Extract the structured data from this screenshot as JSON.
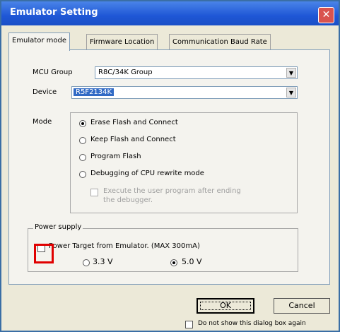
{
  "window": {
    "title": "Emulator Setting",
    "close_glyph": "✕"
  },
  "tabs": [
    {
      "label": "Emulator mode"
    },
    {
      "label": "Firmware Location"
    },
    {
      "label": "Communication Baud Rate"
    }
  ],
  "mcu_group": {
    "label": "MCU Group",
    "value": "R8C/34K Group"
  },
  "device": {
    "label": "Device",
    "value": "R5F2134K"
  },
  "mode": {
    "label": "Mode",
    "options": [
      {
        "label": "Erase Flash and Connect",
        "selected": true
      },
      {
        "label": "Keep Flash and Connect",
        "selected": false
      },
      {
        "label": "Program Flash",
        "selected": false
      },
      {
        "label": "Debugging of CPU rewrite mode",
        "selected": false
      }
    ],
    "sub_option": {
      "line1": "Execute the user program after ending",
      "line2": "the debugger.",
      "enabled": false
    }
  },
  "power": {
    "group_label": "Power supply",
    "checkbox_label": "Power Target from Emulator. (MAX 300mA)",
    "checked": false,
    "voltages": [
      {
        "label": "3.3 V",
        "selected": false
      },
      {
        "label": "5.0 V",
        "selected": true
      }
    ]
  },
  "buttons": {
    "ok": "OK",
    "cancel": "Cancel"
  },
  "footer": {
    "dont_show_label": "Do not show this dialog box again"
  },
  "colors": {
    "title_bar": "#1f57d6",
    "highlight_box": "#e00000"
  }
}
